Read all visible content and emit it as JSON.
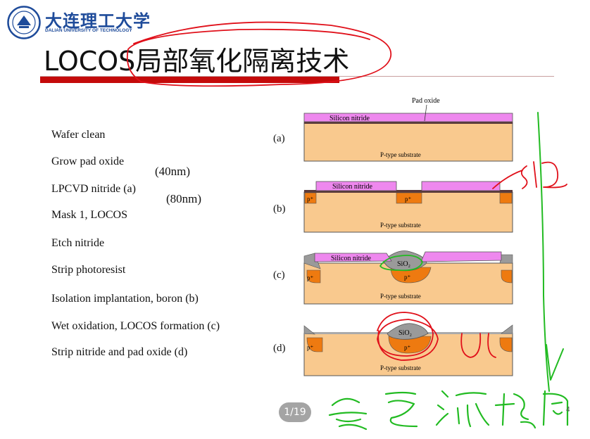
{
  "header": {
    "university_cn": "大连理工大学",
    "university_en": "DALIAN UNIVERSITY OF TECHNOLOGY"
  },
  "title": "LOCOS局部氧化隔离技术",
  "steps": [
    "Wafer clean",
    "Grow pad oxide",
    "LPCVD nitride (a)",
    "Mask 1, LOCOS",
    "Etch nitride",
    "Strip photoresist",
    "Isolation implantation, boron (b)",
    "Wet oxidation, LOCOS formation (c)",
    "Strip nitride and pad oxide (d)"
  ],
  "notes": {
    "pad_oxide_thickness": "(40nm)",
    "nitride_thickness": "(80nm)"
  },
  "panels": [
    {
      "label": "(a)"
    },
    {
      "label": "(b)"
    },
    {
      "label": "(c)"
    },
    {
      "label": "(d)"
    }
  ],
  "diagram_text": {
    "pad_oxide": "Pad oxide",
    "silicon_nitride": "Silicon nitride",
    "substrate": "P-type substrate",
    "p_plus": "p⁺",
    "sio2": "SiO₂"
  },
  "handwriting": {
    "annotation": "SiO2",
    "bottom_note": "会画流程图"
  },
  "viewer": {
    "page_indicator": "1/19",
    "slide_number": "4"
  },
  "colors": {
    "title_bar": "#c40a0a",
    "substrate": "#f9c98e",
    "nitride": "#ee88ee",
    "p_plus": "#ee7a10",
    "oxide": "#9a9a9a",
    "ink_red": "#e0101a",
    "ink_green": "#22bb22"
  }
}
